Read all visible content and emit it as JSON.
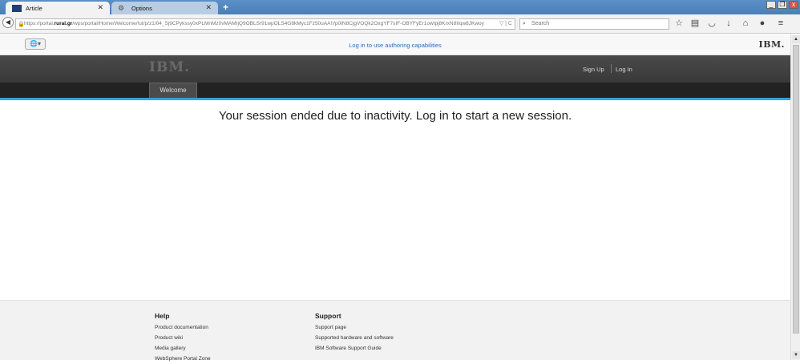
{
  "browser": {
    "tabs": [
      {
        "label": "Article",
        "active": true
      },
      {
        "label": "Options",
        "active": false
      }
    ],
    "new_tab_label": "+",
    "url_prefix": "https://portal.",
    "url_domain": "rural.gr",
    "url_rest": "/wps/portal/Home/Welcome/!ut/p/z1/04_Sj9CPykssy0xPLMnMz0vMAMIjQ9OBLSr91wpOLS4G8kMyc1Fz50uAA!!/p0IN8CjgVOQk2OxgYF7sIF-OBYFyEr1owIpj8KrxN8IIqw8JKwoy",
    "search_placeholder": "Search",
    "window_buttons": [
      "_",
      "❐",
      "x"
    ]
  },
  "portal": {
    "authoring_link": "Log in to use authoring capabilities",
    "brand": "IBM.",
    "sign_up": "Sign Up",
    "log_in": "Log In",
    "nav_tab": "Welcome",
    "session_message": "Your session ended due to inactivity. Log in to start a new session."
  },
  "footer": {
    "help": {
      "title": "Help",
      "links": [
        "Product documentation",
        "Product wiki",
        "Media gallery",
        "WebSphere Portal Zone"
      ]
    },
    "support": {
      "title": "Support",
      "links": [
        "Support page",
        "Supported hardware and software",
        "IBM Software Support Guide"
      ]
    }
  },
  "colors": {
    "accent_line": "#3aa0d8",
    "banner": "#333333",
    "link": "#2a6ebb"
  }
}
